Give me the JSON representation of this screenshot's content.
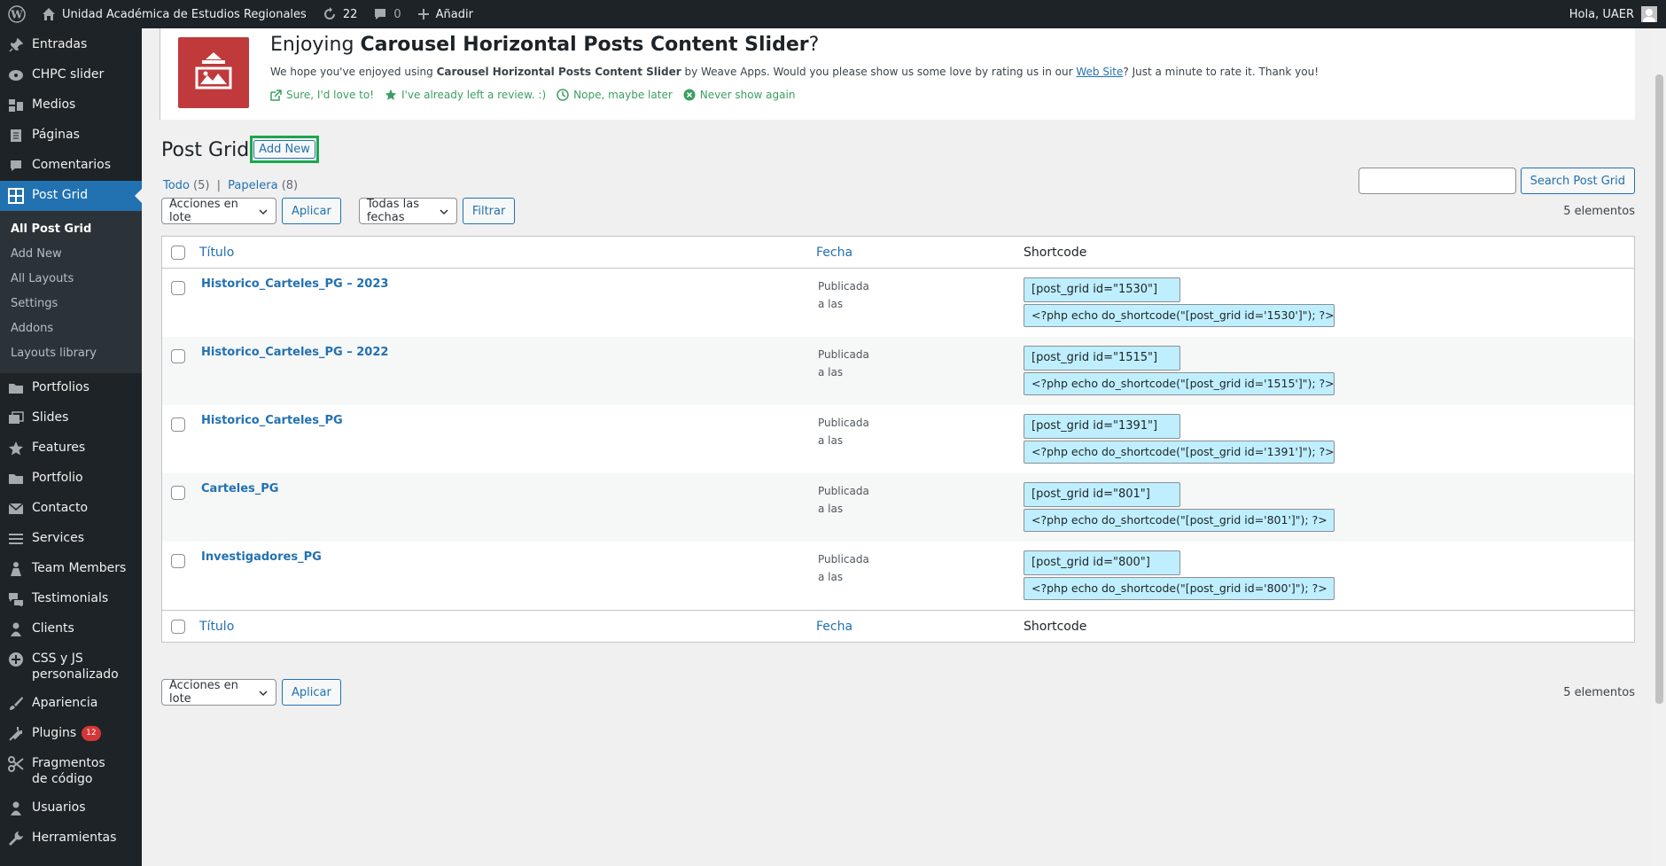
{
  "adminbar": {
    "site_name": "Unidad Académica de Estudios Regionales",
    "updates_count": "22",
    "comments_count": "0",
    "new_label": "Añadir",
    "greeting": "Hola, UAER"
  },
  "sidebar": {
    "items": [
      {
        "label": "Entradas",
        "icon": "pin-icon"
      },
      {
        "label": "CHPC slider",
        "icon": "slider-icon"
      },
      {
        "label": "Medios",
        "icon": "media-icon"
      },
      {
        "label": "Páginas",
        "icon": "page-icon"
      },
      {
        "label": "Comentarios",
        "icon": "comment-icon"
      },
      {
        "label": "Post Grid",
        "icon": "grid-icon"
      }
    ],
    "submenu": [
      "All Post Grid",
      "Add New",
      "All Layouts",
      "Settings",
      "Addons",
      "Layouts library"
    ],
    "items2": [
      {
        "label": "Portfolios",
        "icon": "folder-icon"
      },
      {
        "label": "Slides",
        "icon": "slides-icon"
      },
      {
        "label": "Features",
        "icon": "star-icon"
      },
      {
        "label": "Portfolio",
        "icon": "folder-icon"
      },
      {
        "label": "Contacto",
        "icon": "mail-icon"
      },
      {
        "label": "Services",
        "icon": "list-icon"
      },
      {
        "label": "Team Members",
        "icon": "person-icon"
      },
      {
        "label": "Testimonials",
        "icon": "testimonial-icon"
      },
      {
        "label": "Clients",
        "icon": "users-icon"
      },
      {
        "label": "CSS y JS personalizado",
        "icon": "plus-circle-icon"
      },
      {
        "label": "Apariencia",
        "icon": "brush-icon"
      },
      {
        "label": "Plugins",
        "icon": "plug-icon",
        "badge": "12"
      },
      {
        "label": "Fragmentos de código",
        "icon": "scissors-icon"
      },
      {
        "label": "Usuarios",
        "icon": "user-icon"
      },
      {
        "label": "Herramientas",
        "icon": "wrench-icon"
      }
    ]
  },
  "notice": {
    "title_prefix": "Enjoying ",
    "title_bold": "Carousel Horizontal Posts Content Slider",
    "title_suffix": "?",
    "text_1": "We hope you've enjoyed using ",
    "text_bold": "Carousel Horizontal Posts Content Slider",
    "text_2": " by Weave Apps. Would you please show us some love by rating us in our ",
    "text_link": "Web Site",
    "text_3": "? Just a minute to rate it. Thank you!",
    "links": [
      "Sure, I'd love to!",
      "I've already left a review. :)",
      "Nope, maybe later",
      "Never show again"
    ]
  },
  "page": {
    "title": "Post Grid",
    "add_new": "Add New",
    "filter_all": "Todo",
    "filter_all_count": "(5)",
    "filter_trash": "Papelera",
    "filter_trash_count": "(8)",
    "search_button": "Search Post Grid",
    "bulk_actions": "Acciones en lote",
    "apply": "Aplicar",
    "dates": "Todas las fechas",
    "filter": "Filtrar",
    "count": "5 elementos"
  },
  "table": {
    "col_title": "Título",
    "col_date": "Fecha",
    "col_shortcode": "Shortcode",
    "rows": [
      {
        "title": "Historico_Carteles_PG – 2023",
        "status": "Publicada",
        "date": "a las",
        "sc1": "[post_grid id=\"1530\"]",
        "sc2": "<?php echo do_shortcode(\"[post_grid id='1530']\"); ?>"
      },
      {
        "title": "Historico_Carteles_PG – 2022",
        "status": "Publicada",
        "date": "a las",
        "sc1": "[post_grid id=\"1515\"]",
        "sc2": "<?php echo do_shortcode(\"[post_grid id='1515']\"); ?>"
      },
      {
        "title": "Historico_Carteles_PG",
        "status": "Publicada",
        "date": "a las",
        "sc1": "[post_grid id=\"1391\"]",
        "sc2": "<?php echo do_shortcode(\"[post_grid id='1391']\"); ?>"
      },
      {
        "title": "Carteles_PG",
        "status": "Publicada",
        "date": "a las",
        "sc1": "[post_grid id=\"801\"]",
        "sc2": "<?php echo do_shortcode(\"[post_grid id='801']\"); ?>"
      },
      {
        "title": "Investigadores_PG",
        "status": "Publicada",
        "date": "a las",
        "sc1": "[post_grid id=\"800\"]",
        "sc2": "<?php echo do_shortcode(\"[post_grid id='800']\"); ?>"
      }
    ]
  },
  "colors": {
    "admin_dark": "#1d2327",
    "accent": "#2271b1",
    "highlight_green": "#19a84b",
    "shortcode_bg": "#bfefff"
  }
}
